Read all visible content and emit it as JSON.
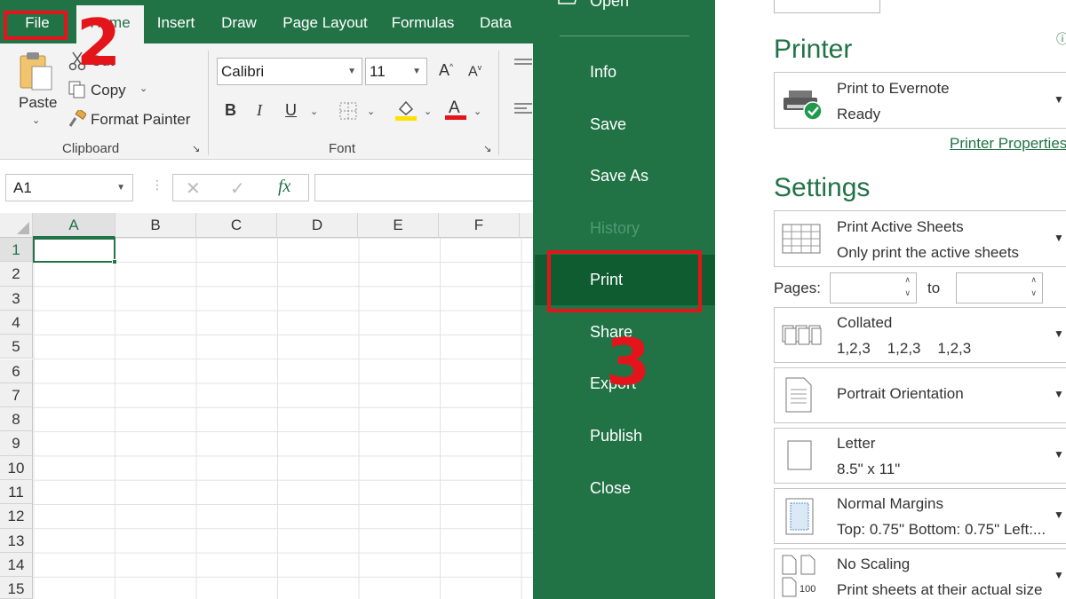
{
  "excel": {
    "tabs": {
      "file": "File",
      "home": "Home",
      "insert": "Insert",
      "draw": "Draw",
      "page_layout": "Page Layout",
      "formulas": "Formulas",
      "data": "Data"
    },
    "clipboard": {
      "paste": "Paste",
      "cut": "Cut",
      "copy": "Copy",
      "format_painter": "Format Painter",
      "group_label": "Clipboard"
    },
    "font": {
      "family": "Calibri",
      "size": "11",
      "bold": "B",
      "italic": "I",
      "underline": "U",
      "group_label": "Font"
    },
    "formula_bar": {
      "name_box": "A1",
      "fx": "fx"
    },
    "columns": [
      "A",
      "B",
      "C",
      "D",
      "E",
      "F"
    ],
    "rows": [
      "1",
      "2",
      "3",
      "4",
      "5",
      "6",
      "7",
      "8",
      "9",
      "10",
      "11",
      "12",
      "13",
      "14",
      "15"
    ]
  },
  "annotations": {
    "step2": "2",
    "step3": "3",
    "color": "#e3151b"
  },
  "backstage": {
    "open": "Open",
    "items": {
      "info": "Info",
      "save": "Save",
      "save_as": "Save As",
      "history": "History",
      "print": "Print",
      "share": "Share",
      "export": "Export",
      "publish": "Publish",
      "close": "Close"
    }
  },
  "print": {
    "printer_title": "Printer",
    "printer_name": "Print to Evernote",
    "printer_status": "Ready",
    "printer_properties": "Printer Properties",
    "settings_title": "Settings",
    "what": {
      "title": "Print Active Sheets",
      "sub": "Only print the active sheets"
    },
    "pages_label": "Pages:",
    "to_label": "to",
    "collation": {
      "title": "Collated",
      "sub": "1,2,3    1,2,3    1,2,3"
    },
    "orientation": {
      "title": "Portrait Orientation"
    },
    "paper": {
      "title": "Letter",
      "sub": "8.5\" x 11\""
    },
    "margins": {
      "title": "Normal Margins",
      "sub": "Top: 0.75\" Bottom: 0.75\" Left:..."
    },
    "scaling": {
      "title": "No Scaling",
      "sub": "Print sheets at their actual size",
      "icon_label": "100"
    }
  },
  "theme": {
    "excel_green": "#217346",
    "dark_green": "#0e5c2f"
  }
}
